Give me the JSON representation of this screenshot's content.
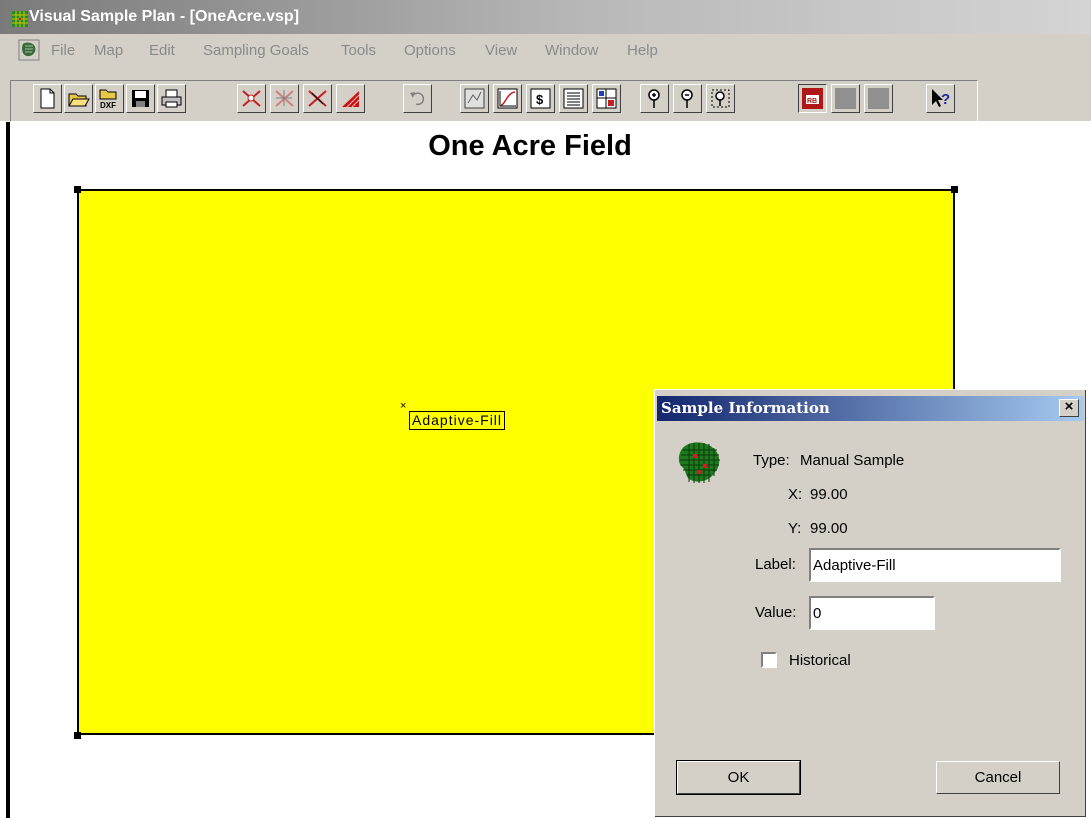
{
  "window": {
    "title": "Visual Sample Plan - [OneAcre.vsp]"
  },
  "menu": {
    "items": [
      "File",
      "Map",
      "Edit",
      "Sampling Goals",
      "Tools",
      "Options",
      "View",
      "Window",
      "Help"
    ]
  },
  "toolbar": {
    "buttons": [
      "new-document",
      "open-folder",
      "import-dxf",
      "save",
      "print",
      "add-sample",
      "move-sample",
      "delete-sample",
      "draw-area",
      "undo",
      "map-view",
      "graph-view",
      "cost-view",
      "report-view",
      "split-view",
      "zoom-in",
      "zoom-out",
      "zoom-extents",
      "color-rb",
      "color-gray-1",
      "color-gray-2",
      "context-help"
    ],
    "dxf_label": "DXF",
    "rb_label": "RB",
    "cost_label": "$",
    "help_label": "?"
  },
  "map": {
    "title": "One Acre Field",
    "sample_label": "Adaptive-Fill",
    "sample_marker": "×",
    "field_color": "#ffff00"
  },
  "dialog": {
    "title": "Sample Information",
    "close_label": "×",
    "type_label": "Type:",
    "type_value": "Manual Sample",
    "x_label": "X:",
    "x_value": "99.00",
    "y_label": "Y:",
    "y_value": "99.00",
    "label_field_label": "Label:",
    "label_field_value": "Adaptive-Fill",
    "value_field_label": "Value:",
    "value_field_value": "0",
    "historical_label": "Historical",
    "historical_checked": false,
    "ok_label": "OK",
    "cancel_label": "Cancel"
  },
  "colors": {
    "title_bar": "#13266d",
    "field": "#ffff00",
    "chrome": "#d4d0c8"
  }
}
